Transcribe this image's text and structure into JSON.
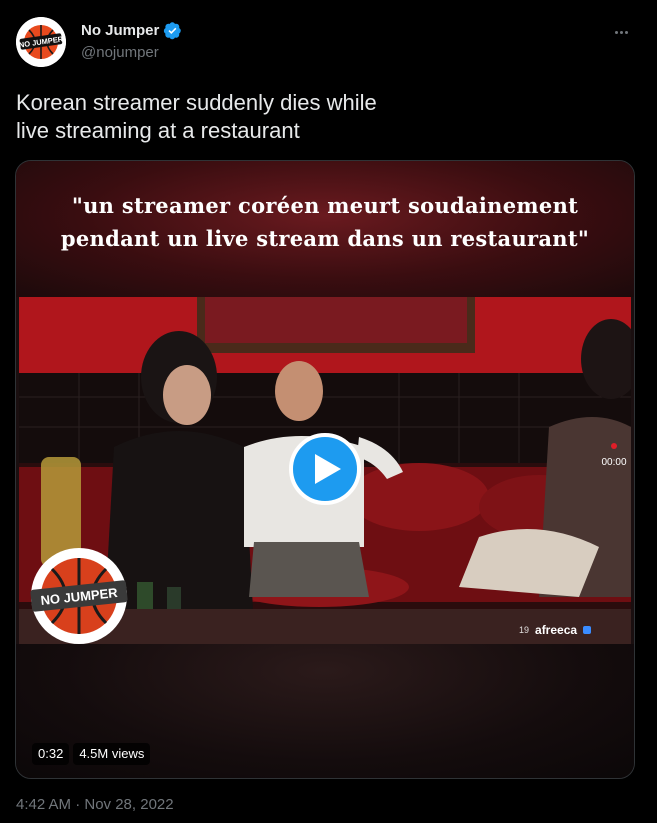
{
  "author": {
    "display_name": "No Jumper",
    "handle": "@nojumper",
    "verified": true,
    "avatar_text": "NO JUMPER"
  },
  "menu": {
    "icon": "more-horizontal-icon"
  },
  "tweet": {
    "text": "Korean streamer suddenly dies while\nlive streaming at a restaurant"
  },
  "media": {
    "caption": "\"un streamer coréen meurt soudainement\npendant un live stream dans un restaurant\"",
    "duration": "0:32",
    "views": "4.5M views",
    "watermark": "NO JUMPER",
    "overlay_timer": "00:00",
    "broadcaster_logo": "afreeca",
    "broadcaster_age": "19",
    "play_icon": "play-icon"
  },
  "meta": {
    "timestamp": "4:42 AM · Nov 28, 2022"
  },
  "colors": {
    "background": "#000000",
    "accent": "#1d9bf0",
    "text": "#e7e9ea",
    "secondary": "#71767b"
  }
}
